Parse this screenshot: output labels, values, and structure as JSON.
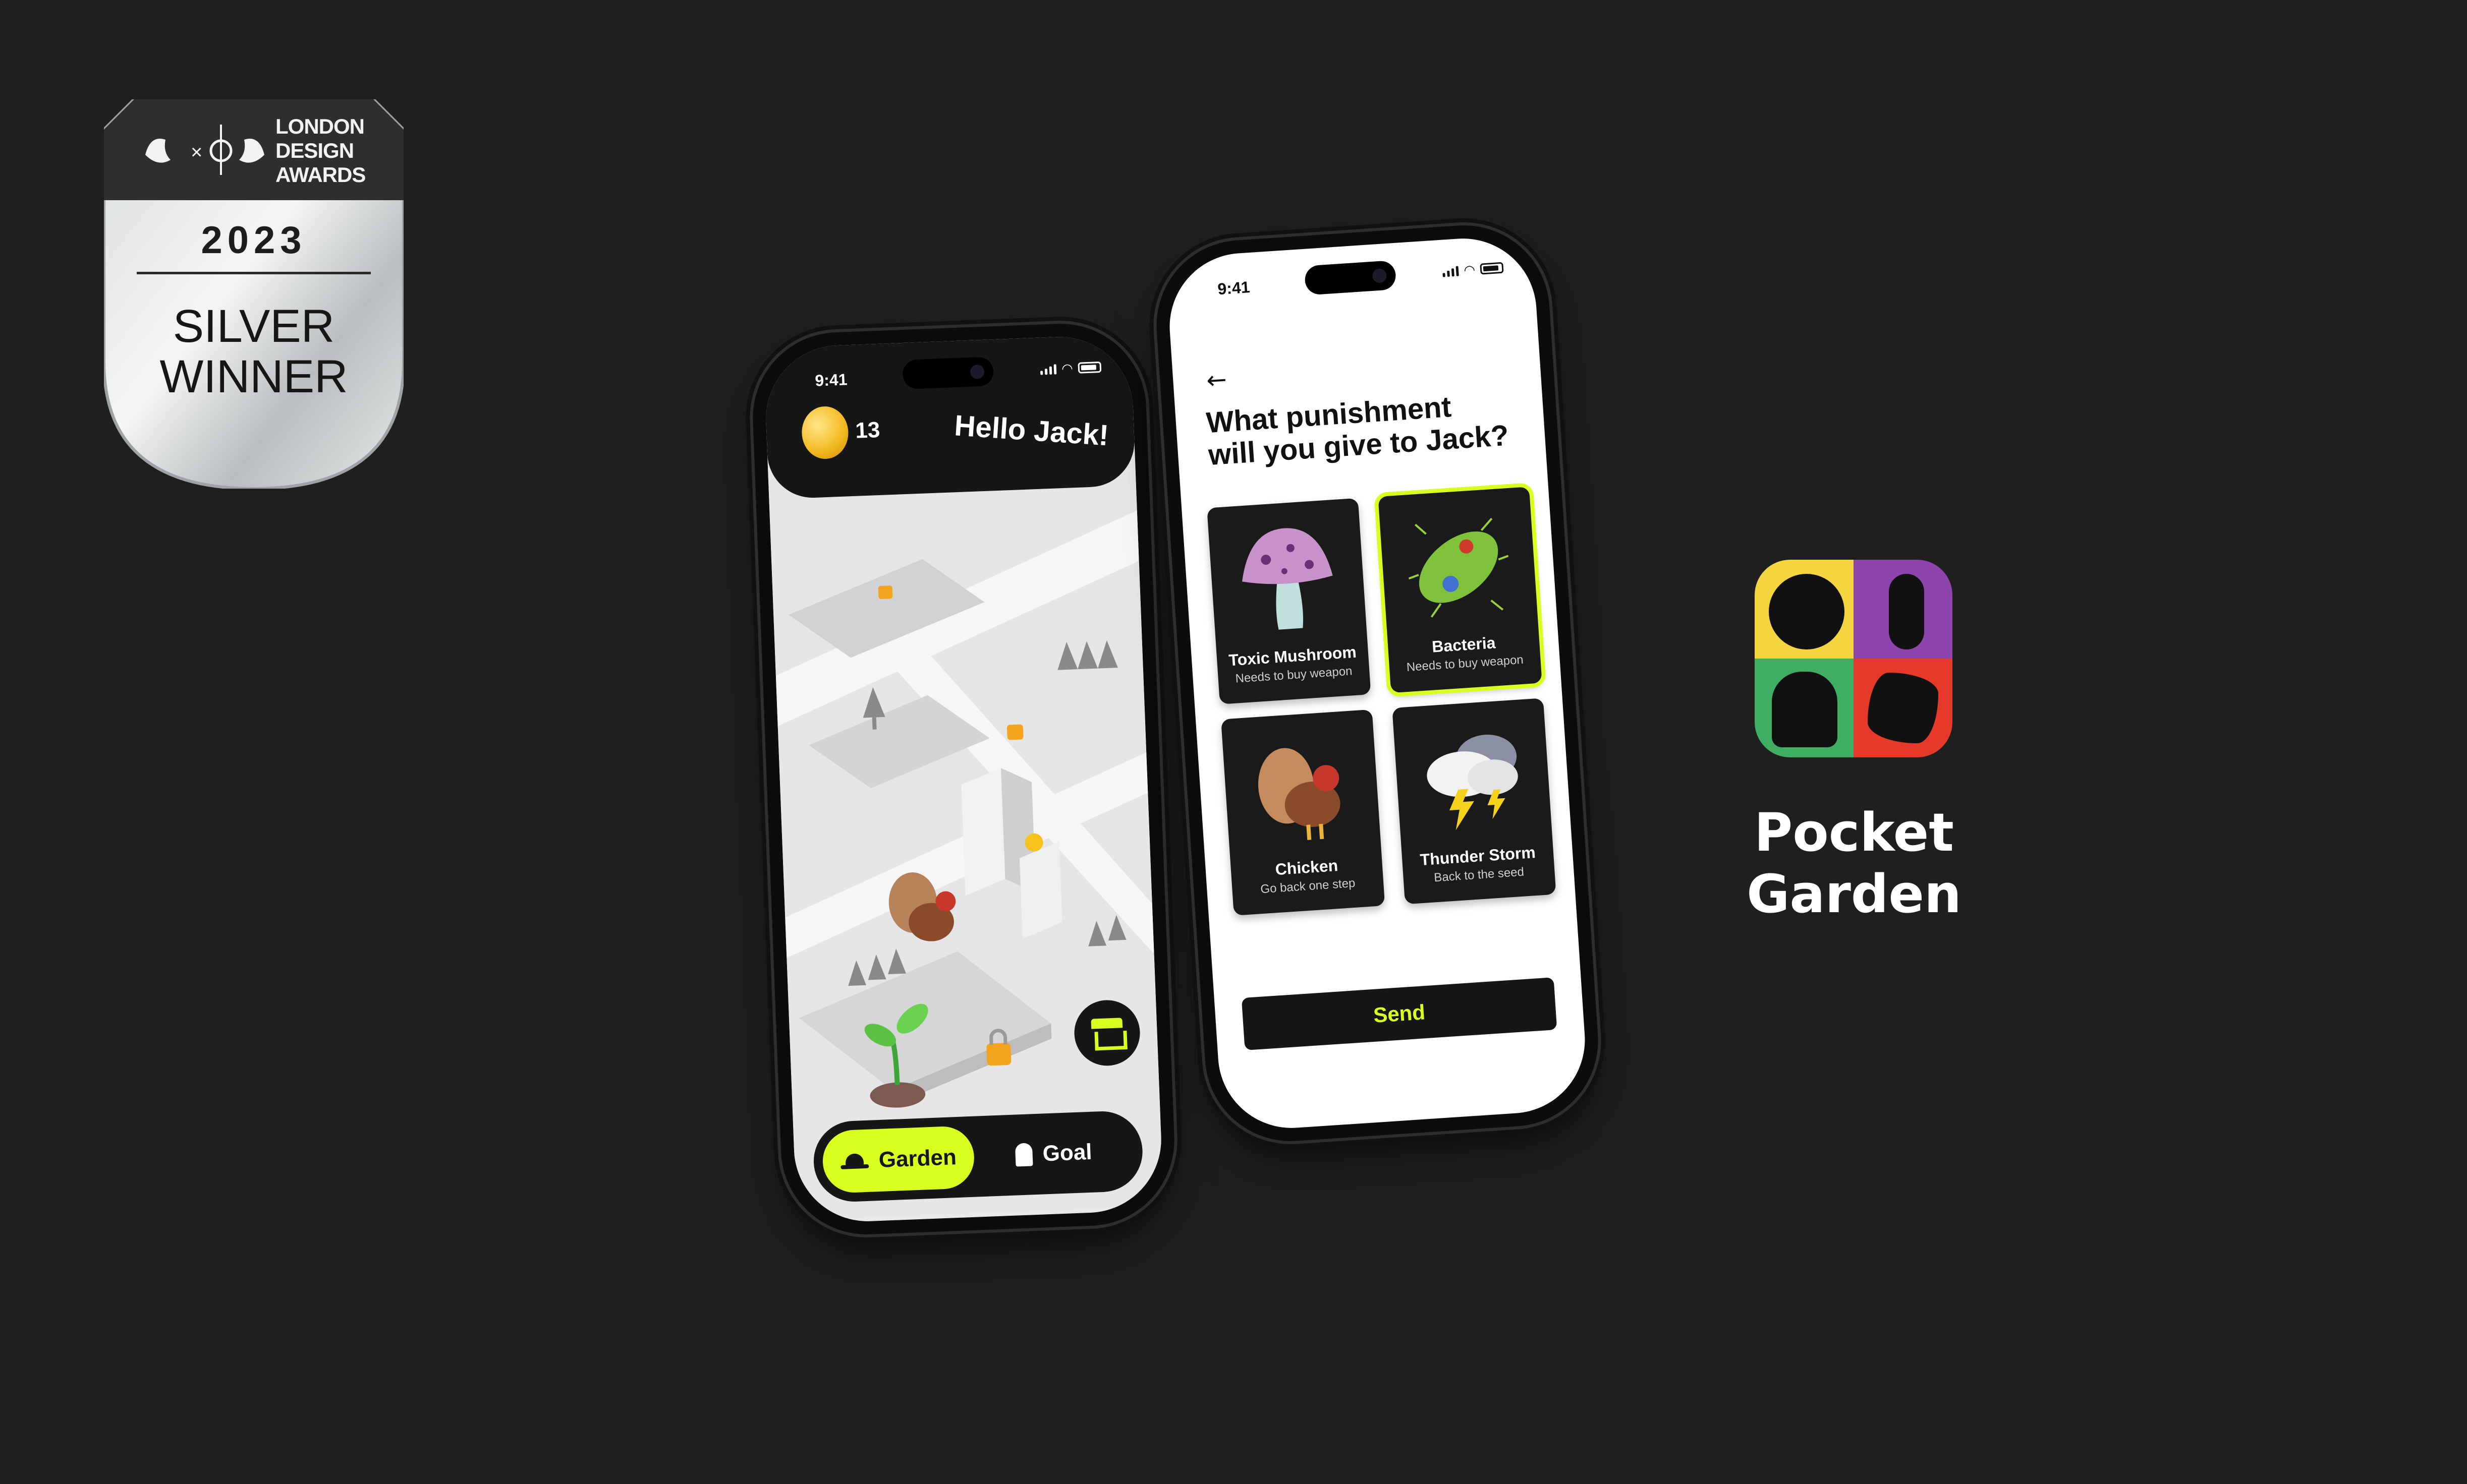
{
  "award": {
    "org_lines": [
      "LONDON",
      "DESIGN",
      "AWARDS"
    ],
    "year": "2023",
    "result_lines": [
      "SILVER",
      "WINNER"
    ]
  },
  "garden_screen": {
    "time": "9:41",
    "coins": "13",
    "greeting": "Hello Jack!",
    "shop_icon": "store-icon",
    "tabs": [
      {
        "label": "Garden",
        "icon": "hat-icon",
        "active": true
      },
      {
        "label": "Goal",
        "icon": "goal-icon",
        "active": false
      }
    ]
  },
  "punish_screen": {
    "time": "9:41",
    "back_icon": "back-arrow-icon",
    "question_lines": [
      "What punishment",
      "will you give to Jack?"
    ],
    "cards": [
      {
        "name": "Toxic Mushroom",
        "desc": "Needs to buy weapon",
        "icon": "mushroom-icon",
        "selected": false
      },
      {
        "name": "Bacteria",
        "desc": "Needs to buy weapon",
        "icon": "bacteria-icon",
        "selected": true
      },
      {
        "name": "Chicken",
        "desc": "Go back one step",
        "icon": "chicken-icon",
        "selected": false
      },
      {
        "name": "Thunder Storm",
        "desc": "Back to the seed",
        "icon": "thunder-cloud-icon",
        "selected": false
      }
    ],
    "send_label": "Send"
  },
  "app": {
    "name": "Pocket Garden",
    "colors": {
      "yellow": "#f4d43f",
      "purple": "#8e44ad",
      "green": "#3fae63",
      "red": "#e53a2a",
      "accent": "#d7ff1f"
    }
  }
}
